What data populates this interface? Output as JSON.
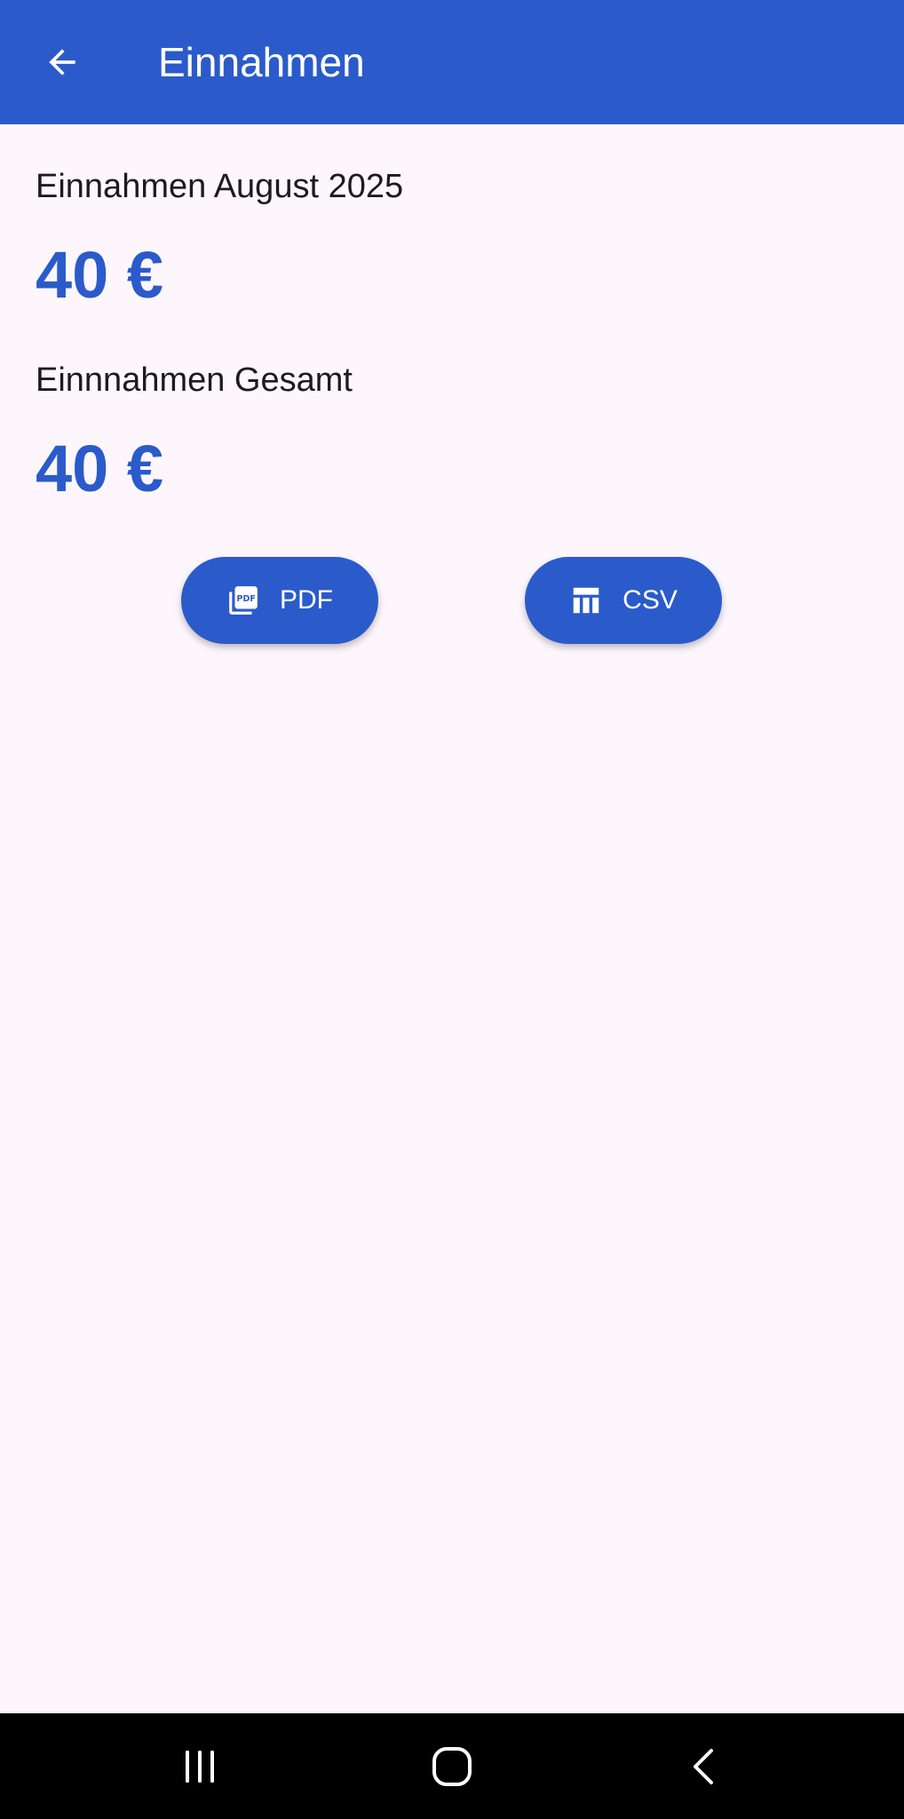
{
  "app_bar": {
    "title": "Einnahmen",
    "back_icon": "arrow-left-icon",
    "background_color": "#2b5bca"
  },
  "summary": {
    "month_label": "Einnahmen August 2025",
    "month_amount": "40 €",
    "total_label": "Einnnahmen Gesamt",
    "total_amount": "40 €",
    "accent_color": "#2b5bca"
  },
  "export_buttons": [
    {
      "label": "PDF",
      "icon": "pdf-file-icon"
    },
    {
      "label": "CSV",
      "icon": "table-icon"
    }
  ],
  "system_nav": {
    "recents_icon": "recents-icon",
    "home_icon": "home-icon",
    "back_icon": "chevron-left-icon"
  }
}
